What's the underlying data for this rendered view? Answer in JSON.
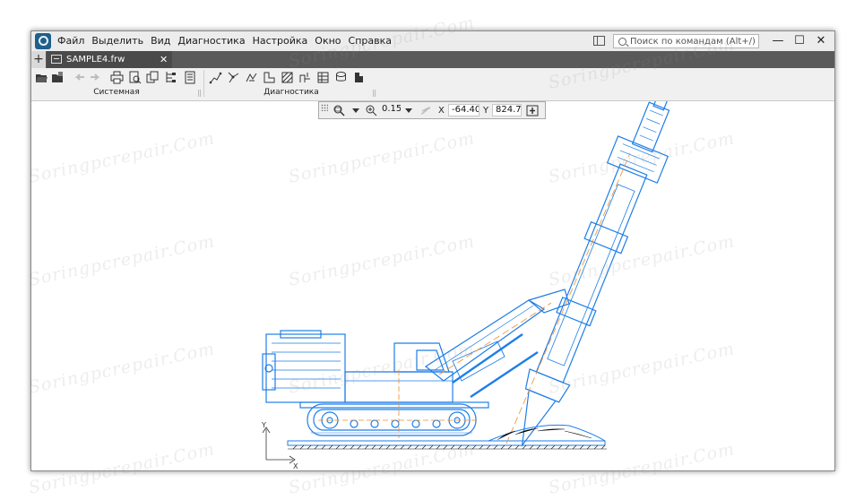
{
  "menubar": {
    "items": [
      "Файл",
      "Выделить",
      "Вид",
      "Диагностика",
      "Настройка",
      "Окно",
      "Справка"
    ],
    "search_placeholder": "Поиск по командам (Alt+/)",
    "window_buttons": {
      "minimize": "—",
      "maximize": "☐",
      "close": "✕"
    }
  },
  "tabs": {
    "add": "+",
    "document": "SAMPLE4.frw",
    "close": "✕"
  },
  "toolbar": {
    "groups": [
      "Системная",
      "Диагностика"
    ]
  },
  "coordinates": {
    "zoom": "0.154",
    "x_label": "X",
    "x_value": "-64.405",
    "y_label": "Y",
    "y_value": "824.75"
  },
  "drawing": {
    "axis_y": "Y",
    "axis_x": "X",
    "line_color": "#1e7ee8",
    "accent_color": "#f08c28"
  },
  "watermark": "Soringpcrepair.Com"
}
